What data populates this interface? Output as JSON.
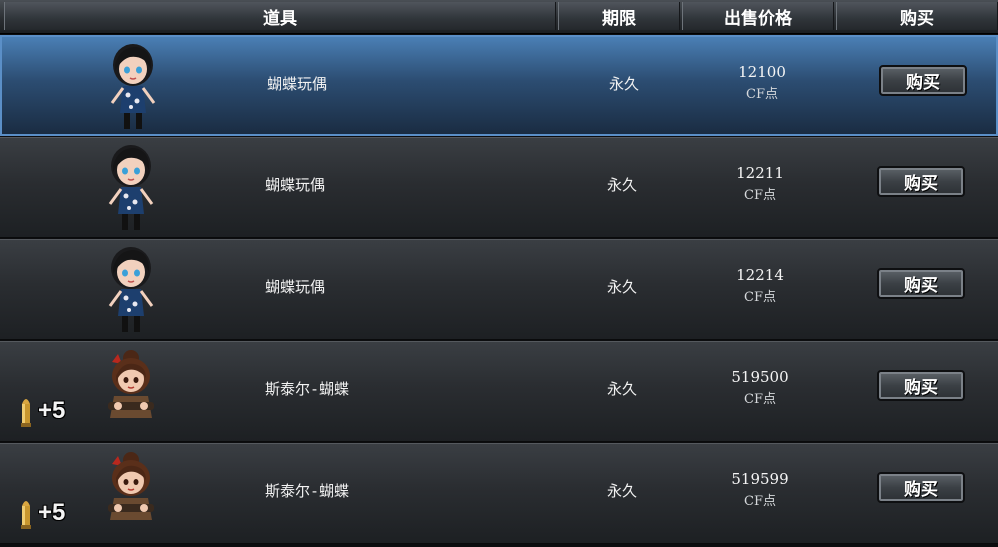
{
  "header": {
    "item": "道具",
    "period": "期限",
    "price": "出售价格",
    "buy": "购买"
  },
  "rows": [
    {
      "name": "蝴蝶玩偶",
      "period": "永久",
      "price": "12100",
      "unit": "CF点",
      "buy_label": "购买",
      "selected": true,
      "badge": ""
    },
    {
      "name": "蝴蝶玩偶",
      "period": "永久",
      "price": "12211",
      "unit": "CF点",
      "buy_label": "购买",
      "selected": false,
      "badge": ""
    },
    {
      "name": "蝴蝶玩偶",
      "period": "永久",
      "price": "12214",
      "unit": "CF点",
      "buy_label": "购买",
      "selected": false,
      "badge": ""
    },
    {
      "name": "斯泰尔-蝴蝶",
      "period": "永久",
      "price": "519500",
      "unit": "CF点",
      "buy_label": "购买",
      "selected": false,
      "badge": "+5"
    },
    {
      "name": "斯泰尔-蝴蝶",
      "period": "永久",
      "price": "519599",
      "unit": "CF点",
      "buy_label": "购买",
      "selected": false,
      "badge": "+5"
    }
  ],
  "colors": {
    "selected_row": "#2c4d72",
    "row": "#2a2d31",
    "header": "#30353a"
  },
  "icons": {
    "doll": "butterfly-doll-icon",
    "steyr": "steyr-butterfly-icon",
    "bullet": "bullet-icon"
  }
}
